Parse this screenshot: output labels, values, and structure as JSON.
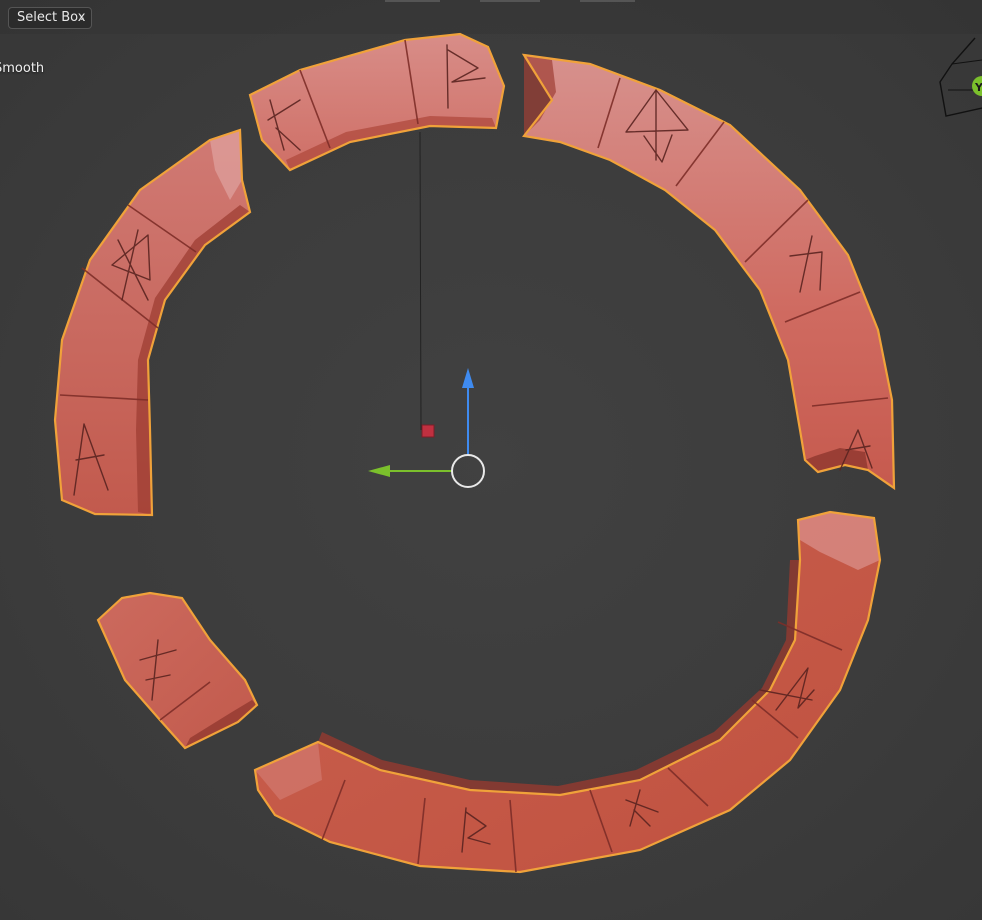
{
  "header": {
    "select_mode_label": "Select Box",
    "select_mode_chevron": "chevron-down-icon"
  },
  "overlay": {
    "shading_label": "Smooth"
  },
  "gizmo": {
    "axis_label": "Y",
    "axis_color": "#7bc02c"
  },
  "colors": {
    "viewport_bg": "#3d3d3d",
    "stone_base": "#c75a4c",
    "stone_light": "#d98a86",
    "selection_outline": "#f0a23a",
    "axis_z": "#3f8bf0",
    "axis_y": "#7bc02c",
    "origin_marker": "#c03040"
  }
}
